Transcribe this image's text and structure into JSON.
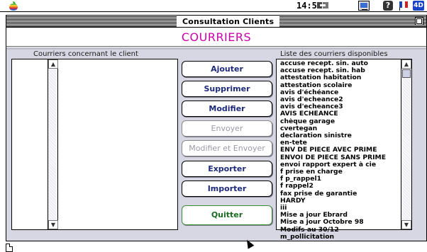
{
  "menubar": {
    "time": "14:57",
    "icons": [
      "apple-icon",
      "sync-icon",
      "monitor-icon",
      "help-icon",
      "flag-icon",
      "app-icon"
    ],
    "help_glyph": "?",
    "app_glyph": "4D"
  },
  "window": {
    "title": "Consultation Clients"
  },
  "header": {
    "title": "COURRIERS",
    "title_color": "#cc00aa"
  },
  "left_panel": {
    "label": "Courriers concernant le client",
    "items": []
  },
  "right_panel": {
    "label": "Liste des courriers disponibles",
    "items": [
      "accuse recept. sin. auto",
      "accuse recept. sin. hab",
      "attestation habitation",
      "attestation scolaire",
      "avis d'échéance",
      "avis d'echeance2",
      "avis d'echeance3",
      "AVIS ECHEANCE",
      "chèque garage",
      "cvertegan",
      "declaration sinistre",
      "en-tete",
      "ENV DE PIECE AVEC PRIME",
      "ENVOI DE PIECE SANS PRIME",
      "envoi rapport expert à cie",
      "f prise en charge",
      "f p_rappel1",
      "f rappel2",
      "fax prise de garantie",
      "HARDY",
      "iii",
      "Mise a jour Ebrard",
      "Mise a jour Octobre 98",
      "Modifs au 30/12",
      "m_pollicitation"
    ]
  },
  "buttons": {
    "ajouter": "Ajouter",
    "supprimer": "Supprimer",
    "modifier": "Modifier",
    "envoyer": "Envoyer",
    "modifier_envoyer": "Modifier et Envoyer",
    "exporter": "Exporter",
    "importer": "Importer",
    "quitter": "Quitter"
  },
  "colors": {
    "button_text": "#1d2a7a",
    "quit_text": "#1a6a22",
    "content_bg": "#d7d7e3"
  }
}
